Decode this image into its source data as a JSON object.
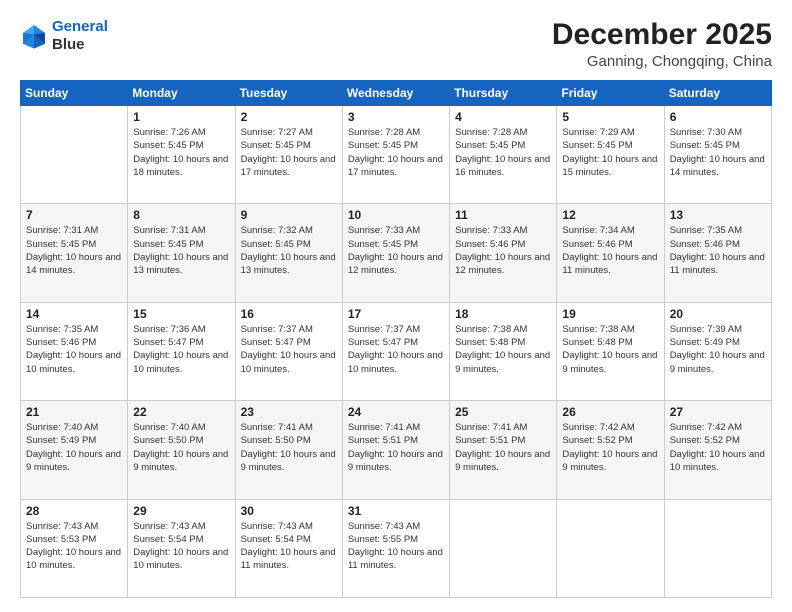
{
  "logo": {
    "line1": "General",
    "line2": "Blue"
  },
  "header": {
    "title": "December 2025",
    "subtitle": "Ganning, Chongqing, China"
  },
  "days_of_week": [
    "Sunday",
    "Monday",
    "Tuesday",
    "Wednesday",
    "Thursday",
    "Friday",
    "Saturday"
  ],
  "weeks": [
    [
      null,
      {
        "day": 1,
        "sunrise": "7:26 AM",
        "sunset": "5:45 PM",
        "daylight": "10 hours and 18 minutes."
      },
      {
        "day": 2,
        "sunrise": "7:27 AM",
        "sunset": "5:45 PM",
        "daylight": "10 hours and 17 minutes."
      },
      {
        "day": 3,
        "sunrise": "7:28 AM",
        "sunset": "5:45 PM",
        "daylight": "10 hours and 17 minutes."
      },
      {
        "day": 4,
        "sunrise": "7:28 AM",
        "sunset": "5:45 PM",
        "daylight": "10 hours and 16 minutes."
      },
      {
        "day": 5,
        "sunrise": "7:29 AM",
        "sunset": "5:45 PM",
        "daylight": "10 hours and 15 minutes."
      },
      {
        "day": 6,
        "sunrise": "7:30 AM",
        "sunset": "5:45 PM",
        "daylight": "10 hours and 14 minutes."
      }
    ],
    [
      {
        "day": 7,
        "sunrise": "7:31 AM",
        "sunset": "5:45 PM",
        "daylight": "10 hours and 14 minutes."
      },
      {
        "day": 8,
        "sunrise": "7:31 AM",
        "sunset": "5:45 PM",
        "daylight": "10 hours and 13 minutes."
      },
      {
        "day": 9,
        "sunrise": "7:32 AM",
        "sunset": "5:45 PM",
        "daylight": "10 hours and 13 minutes."
      },
      {
        "day": 10,
        "sunrise": "7:33 AM",
        "sunset": "5:45 PM",
        "daylight": "10 hours and 12 minutes."
      },
      {
        "day": 11,
        "sunrise": "7:33 AM",
        "sunset": "5:46 PM",
        "daylight": "10 hours and 12 minutes."
      },
      {
        "day": 12,
        "sunrise": "7:34 AM",
        "sunset": "5:46 PM",
        "daylight": "10 hours and 11 minutes."
      },
      {
        "day": 13,
        "sunrise": "7:35 AM",
        "sunset": "5:46 PM",
        "daylight": "10 hours and 11 minutes."
      }
    ],
    [
      {
        "day": 14,
        "sunrise": "7:35 AM",
        "sunset": "5:46 PM",
        "daylight": "10 hours and 10 minutes."
      },
      {
        "day": 15,
        "sunrise": "7:36 AM",
        "sunset": "5:47 PM",
        "daylight": "10 hours and 10 minutes."
      },
      {
        "day": 16,
        "sunrise": "7:37 AM",
        "sunset": "5:47 PM",
        "daylight": "10 hours and 10 minutes."
      },
      {
        "day": 17,
        "sunrise": "7:37 AM",
        "sunset": "5:47 PM",
        "daylight": "10 hours and 10 minutes."
      },
      {
        "day": 18,
        "sunrise": "7:38 AM",
        "sunset": "5:48 PM",
        "daylight": "10 hours and 9 minutes."
      },
      {
        "day": 19,
        "sunrise": "7:38 AM",
        "sunset": "5:48 PM",
        "daylight": "10 hours and 9 minutes."
      },
      {
        "day": 20,
        "sunrise": "7:39 AM",
        "sunset": "5:49 PM",
        "daylight": "10 hours and 9 minutes."
      }
    ],
    [
      {
        "day": 21,
        "sunrise": "7:40 AM",
        "sunset": "5:49 PM",
        "daylight": "10 hours and 9 minutes."
      },
      {
        "day": 22,
        "sunrise": "7:40 AM",
        "sunset": "5:50 PM",
        "daylight": "10 hours and 9 minutes."
      },
      {
        "day": 23,
        "sunrise": "7:41 AM",
        "sunset": "5:50 PM",
        "daylight": "10 hours and 9 minutes."
      },
      {
        "day": 24,
        "sunrise": "7:41 AM",
        "sunset": "5:51 PM",
        "daylight": "10 hours and 9 minutes."
      },
      {
        "day": 25,
        "sunrise": "7:41 AM",
        "sunset": "5:51 PM",
        "daylight": "10 hours and 9 minutes."
      },
      {
        "day": 26,
        "sunrise": "7:42 AM",
        "sunset": "5:52 PM",
        "daylight": "10 hours and 9 minutes."
      },
      {
        "day": 27,
        "sunrise": "7:42 AM",
        "sunset": "5:52 PM",
        "daylight": "10 hours and 10 minutes."
      }
    ],
    [
      {
        "day": 28,
        "sunrise": "7:43 AM",
        "sunset": "5:53 PM",
        "daylight": "10 hours and 10 minutes."
      },
      {
        "day": 29,
        "sunrise": "7:43 AM",
        "sunset": "5:54 PM",
        "daylight": "10 hours and 10 minutes."
      },
      {
        "day": 30,
        "sunrise": "7:43 AM",
        "sunset": "5:54 PM",
        "daylight": "10 hours and 11 minutes."
      },
      {
        "day": 31,
        "sunrise": "7:43 AM",
        "sunset": "5:55 PM",
        "daylight": "10 hours and 11 minutes."
      },
      null,
      null,
      null
    ]
  ]
}
